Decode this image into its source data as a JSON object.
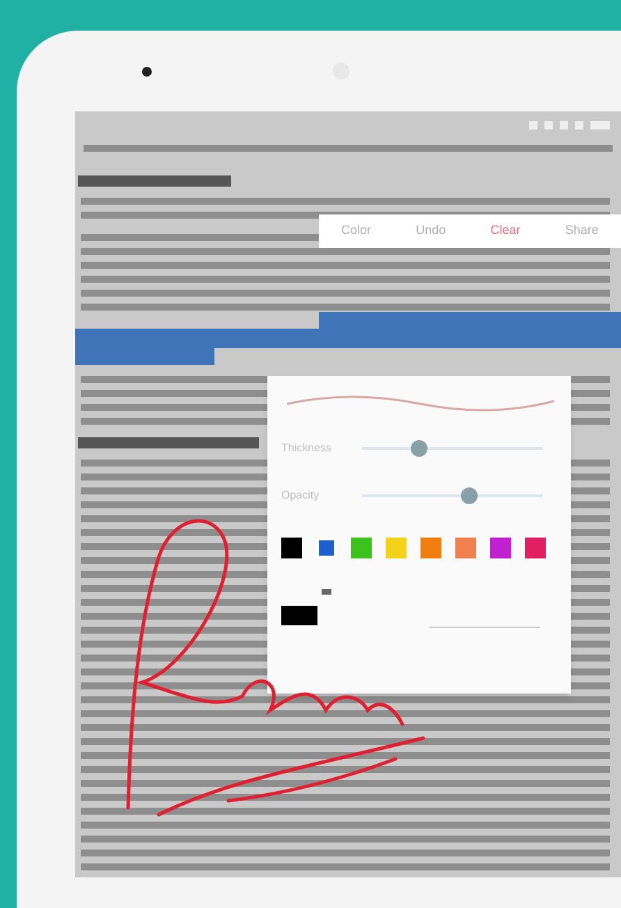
{
  "toolbar": {
    "items": [
      {
        "label": "Color",
        "kind": "normal"
      },
      {
        "label": "Undo",
        "kind": "normal"
      },
      {
        "label": "Clear",
        "kind": "danger"
      },
      {
        "label": "Share",
        "kind": "normal"
      }
    ]
  },
  "pen_settings": {
    "sliders": [
      {
        "label": "Thickness",
        "level": 0.3
      },
      {
        "label": "Opacity",
        "level": 0.6
      }
    ],
    "swatches": [
      {
        "color": "#000000",
        "selected": false
      },
      {
        "color": "#1e5fd0",
        "selected": true
      },
      {
        "color": "#3cc21c",
        "selected": false
      },
      {
        "color": "#f2d21a",
        "selected": false
      },
      {
        "color": "#f07f10",
        "selected": false
      },
      {
        "color": "#f08050",
        "selected": false
      },
      {
        "color": "#c020d0",
        "selected": false
      },
      {
        "color": "#e02060",
        "selected": false
      }
    ]
  }
}
